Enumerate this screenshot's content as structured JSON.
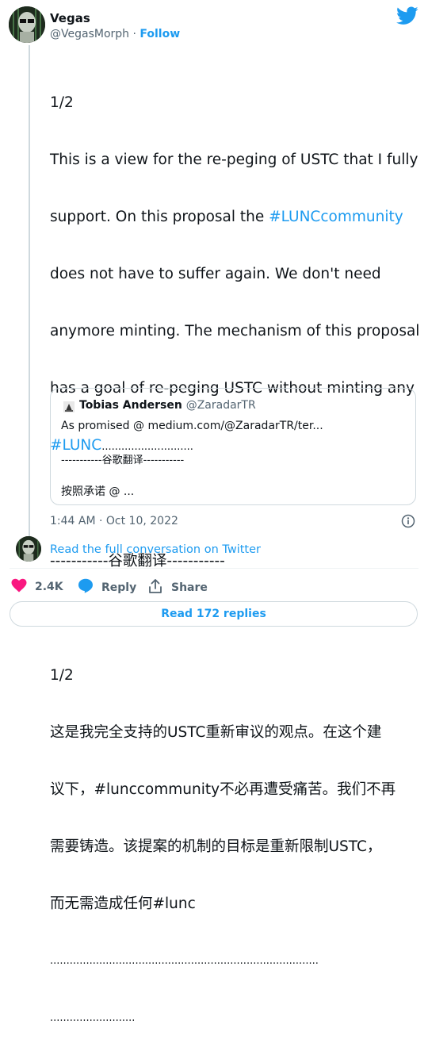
{
  "author": {
    "name": "Vegas",
    "handle": "@VegasMorph",
    "separator": "·",
    "follow_label": "Follow"
  },
  "tweet": {
    "lines": [
      {
        "text": "1/2"
      },
      {
        "text": "This is a view for the re-peging of USTC that I fully"
      },
      {
        "text_before": "support. On this proposal the ",
        "hashtag": "#LUNCcommunity"
      },
      {
        "text": "does not have to suffer again. We don't need"
      },
      {
        "text": "anymore minting. The mechanism of this proposal"
      },
      {
        "text": "has a goal of re-peging USTC without minting any"
      },
      {
        "hashtag": "#LUNC",
        "text_after": "............................"
      },
      {
        "text": ""
      },
      {
        "text": "-----------谷歌翻译-----------"
      },
      {
        "text": ""
      },
      {
        "text": "1/2"
      },
      {
        "text": "这是我完全支持的USTC重新审议的观点。在这个建"
      },
      {
        "text": "议下，#lunccommunity不必再遭受痛苦。我们不再"
      },
      {
        "text": "需要铸造。该提案的机制的目标是重新限制USTC，"
      },
      {
        "text": "而无需造成任何#lunc"
      },
      {
        "text": ".................................................................................."
      },
      {
        "text": ".........................."
      }
    ]
  },
  "quote": {
    "name": "Tobias Andersen",
    "handle": "@ZaradarTR",
    "line1": "As promised @ medium.com/@ZaradarTR/ter...",
    "line2": "-----------谷歌翻译-----------",
    "line3": "按照承诺 @ ..."
  },
  "meta": {
    "timestamp": "1:44 AM · Oct 10, 2022"
  },
  "read_full": "Read the full conversation on Twitter",
  "actions": {
    "likes": "2.4K",
    "reply_label": "Reply",
    "share_label": "Share"
  },
  "read_replies": "Read 172 replies",
  "colors": {
    "link": "#1d9bf0",
    "heart": "#f91880",
    "muted": "#536471",
    "border": "#cfd9de"
  }
}
